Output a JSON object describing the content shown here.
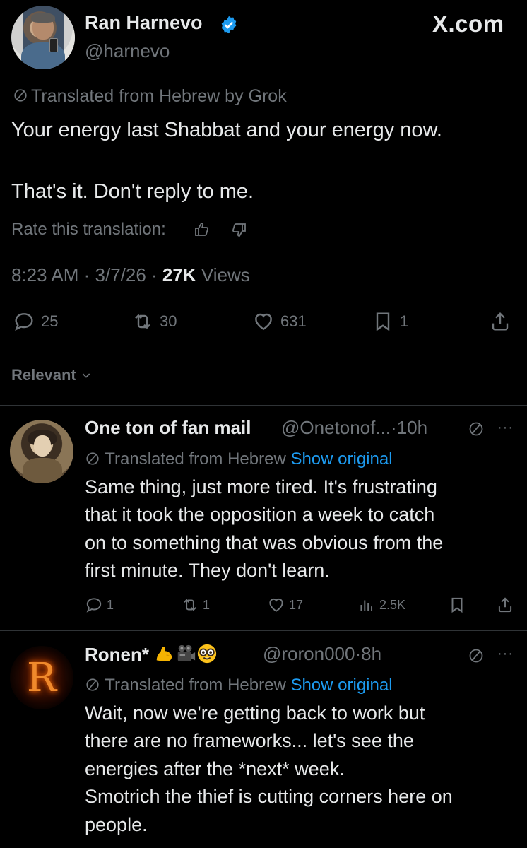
{
  "brand": {
    "site": "X.com"
  },
  "main_tweet": {
    "author_name": "Ran Harnevo",
    "handle": "@harnevo",
    "translated_label": "Translated from Hebrew by Grok",
    "text_line1": "Your energy last Shabbat and your energy now.",
    "text_line2": "That's it. Don't reply to me.",
    "rate_label": "Rate this translation:",
    "time": "8:23 AM",
    "date": "3/7/26",
    "views_count": "27K",
    "views_label": "Views",
    "replies": "25",
    "reposts": "30",
    "likes": "631",
    "bookmarks": "1"
  },
  "sort": {
    "label": "Relevant"
  },
  "replies": [
    {
      "name": "One ton of fan mail",
      "handle": "@Onetonof...",
      "time": "10h",
      "translated_label": "Translated from Hebrew",
      "show_original": "Show original",
      "lines": [
        "Same thing, just more tired. It's frustrating",
        "that it took the opposition a week to catch",
        "on to something that was obvious from the",
        "first minute. They don't learn."
      ],
      "replies": "1",
      "reposts": "1",
      "likes": "17",
      "views": "2.5K"
    },
    {
      "name": "Ronen*",
      "handle": "@roron000",
      "time": "8h",
      "avatar_letter": "R",
      "translated_label": "Translated from Hebrew",
      "show_original": "Show original",
      "lines": [
        "Wait, now we're getting back to work but",
        "there are no frameworks... let's see the",
        "energies after the *next* week.",
        "Smotrich the thief is cutting corners here on",
        "people."
      ]
    }
  ],
  "colors": {
    "background": "#000000",
    "text": "#e7e9ea",
    "muted": "#71767b",
    "link": "#1d9bf0",
    "verified": "#1d9bf0"
  }
}
